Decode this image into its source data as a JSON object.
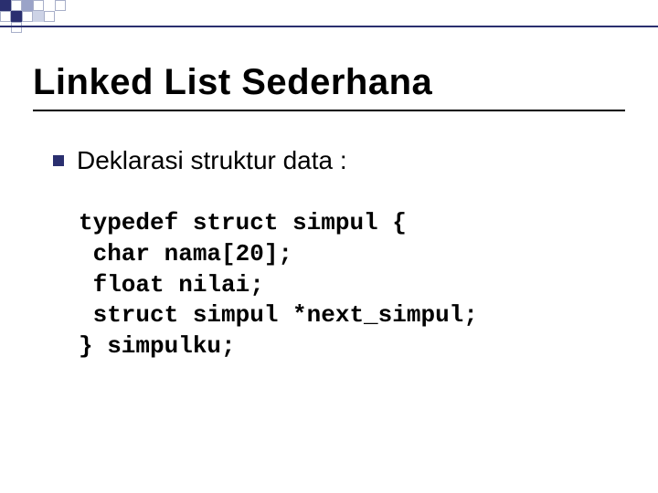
{
  "title": "Linked List Sederhana",
  "bullet": {
    "text": "Deklarasi struktur data :"
  },
  "code": {
    "line1": "typedef struct simpul {",
    "line2": " char nama[20];",
    "line3": " float nilai;",
    "line4": " struct simpul *next_simpul;",
    "line5": "} simpulku;"
  }
}
